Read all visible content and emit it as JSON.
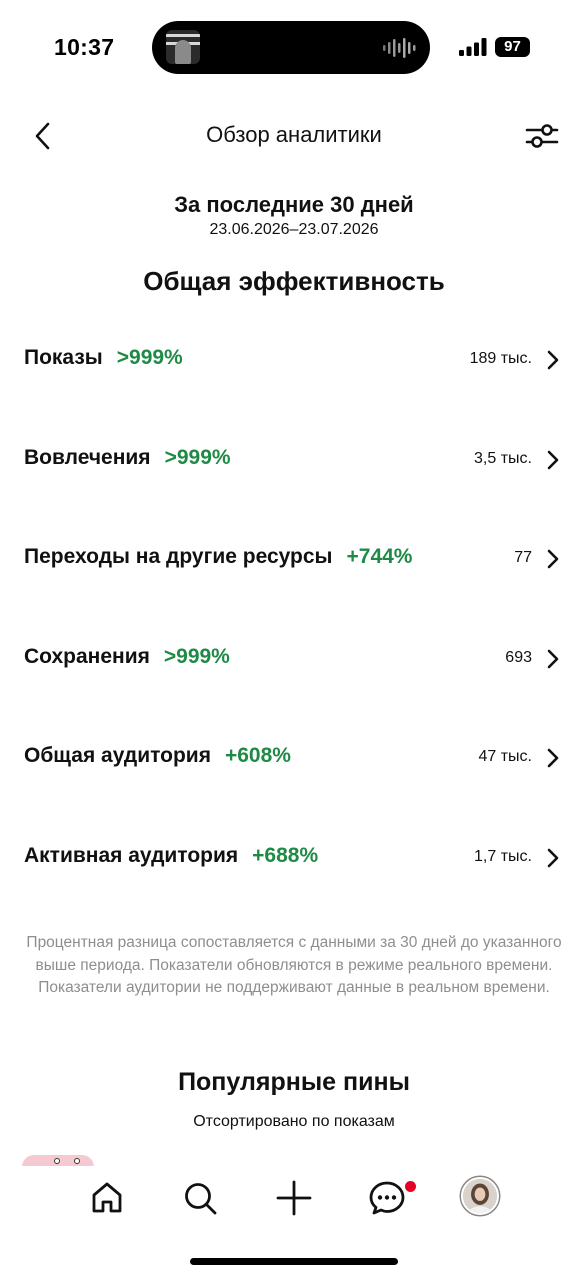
{
  "status_bar": {
    "time": "10:37",
    "battery": "97",
    "icons": [
      "signal-icon",
      "battery-icon",
      "audio-wave-icon"
    ]
  },
  "header": {
    "title": "Обзор аналитики",
    "icons": [
      "chevron-left-icon",
      "filter-sliders-icon"
    ]
  },
  "period": {
    "title": "За последние 30 дней",
    "range": "23.06.2026–23.07.2026"
  },
  "overall": {
    "title": "Общая эффективность",
    "metrics": [
      {
        "label": "Показы",
        "change": ">999%",
        "value": "189 тыс."
      },
      {
        "label": "Вовлечения",
        "change": ">999%",
        "value": "3,5 тыс."
      },
      {
        "label": "Переходы на другие ресурсы",
        "change": "+744%",
        "value": "77"
      },
      {
        "label": "Сохранения",
        "change": ">999%",
        "value": "693"
      },
      {
        "label": "Общая аудитория",
        "change": "+608%",
        "value": "47 тыс."
      },
      {
        "label": "Активная аудитория",
        "change": "+688%",
        "value": "1,7 тыс."
      }
    ]
  },
  "disclaimer": "Процентная разница сопоставляется с данными за 30 дней до указанного выше периода. Показатели обновляются в режиме реального времени. Показатели аудитории не поддерживают данные в реальном времени.",
  "popular": {
    "title": "Популярные пины",
    "subtitle": "Отсортировано по показам"
  },
  "bottom_nav": {
    "items": [
      "home-icon",
      "search-icon",
      "plus-icon",
      "messages-icon",
      "profile-avatar"
    ]
  },
  "colors": {
    "positive": "#1f8a46",
    "muted_text": "#8e8e8e",
    "notification": "#e60023"
  }
}
